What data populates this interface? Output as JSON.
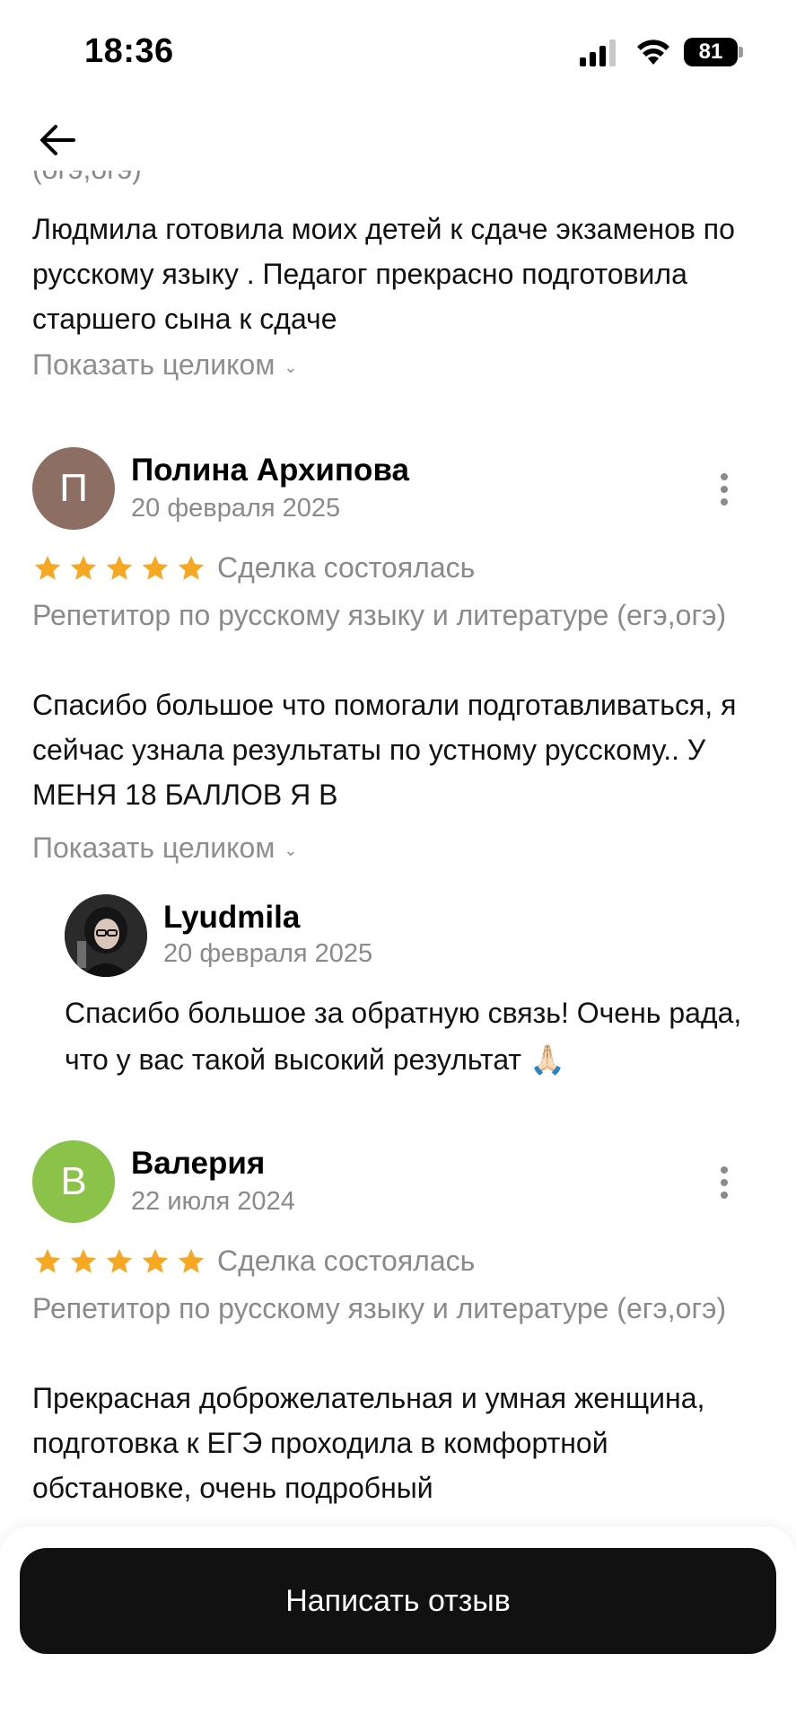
{
  "status_bar": {
    "time": "18:36",
    "battery": "81"
  },
  "prev_review": {
    "cut_text": "(огэ,огэ)",
    "text": "Людмила готовила моих детей к сдаче экзаменов  по русскому языку .  Педагог прекрасно подготовила старшего сына к сдаче",
    "show_more": "Показать целиком"
  },
  "reviews": [
    {
      "avatar_letter": "П",
      "avatar_color": "#8d6e63",
      "author": "Полина Архипова",
      "date": "20 февраля 2025",
      "rating": 5,
      "status": "Сделка состоялась",
      "service": "Репетитор по русскому языку и литературе (егэ,огэ)",
      "text": "Спасибо большое что помогали подготавливаться, я сейчас узнала результаты по устному русскому.. У МЕНЯ 18 БАЛЛОВ Я В",
      "show_more": "Показать целиком",
      "reply": {
        "author": "Lyudmila",
        "date": "20 февраля 2025",
        "text": "Спасибо большое за обратную связь! Очень рада, что у вас такой высокий результат 🙏🏻"
      }
    },
    {
      "avatar_letter": "В",
      "avatar_color": "#8bc34a",
      "author": "Валерия",
      "date": "22 июля 2024",
      "rating": 5,
      "status": "Сделка состоялась",
      "service": "Репетитор по русскому языку и литературе (егэ,огэ)",
      "text": "Прекрасная доброжелательная и умная женщина, подготовка к ЕГЭ проходила в комфортной обстановке, очень подробный"
    }
  ],
  "write_review_label": "Написать отзыв",
  "colors": {
    "star": "#f7a823",
    "muted": "#8a8a8a",
    "button": "#111111"
  }
}
